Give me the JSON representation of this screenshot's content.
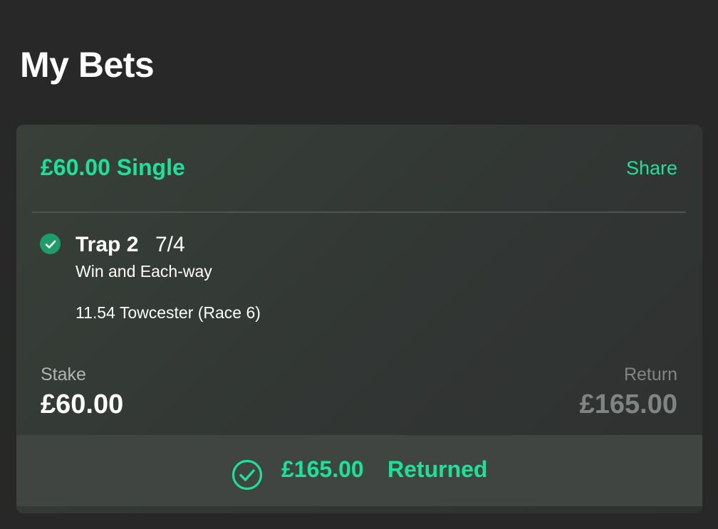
{
  "page": {
    "title": "My Bets"
  },
  "bet": {
    "title": "£60.00 Single",
    "share_label": "Share",
    "selection": {
      "name": "Trap 2",
      "odds": "7/4",
      "market": "Win and Each-way",
      "event": "11.54 Towcester (Race 6)",
      "status_icon": "check-circle-icon"
    },
    "stake_label": "Stake",
    "stake_value": "£60.00",
    "return_label": "Return",
    "return_value": "£165.00",
    "result": {
      "icon": "check-circle-outline-icon",
      "amount": "£165.00",
      "label": "Returned"
    }
  },
  "colors": {
    "accent": "#1be29a",
    "background": "#282828",
    "card": "#343a37",
    "banner": "#414542",
    "muted": "#808583"
  }
}
